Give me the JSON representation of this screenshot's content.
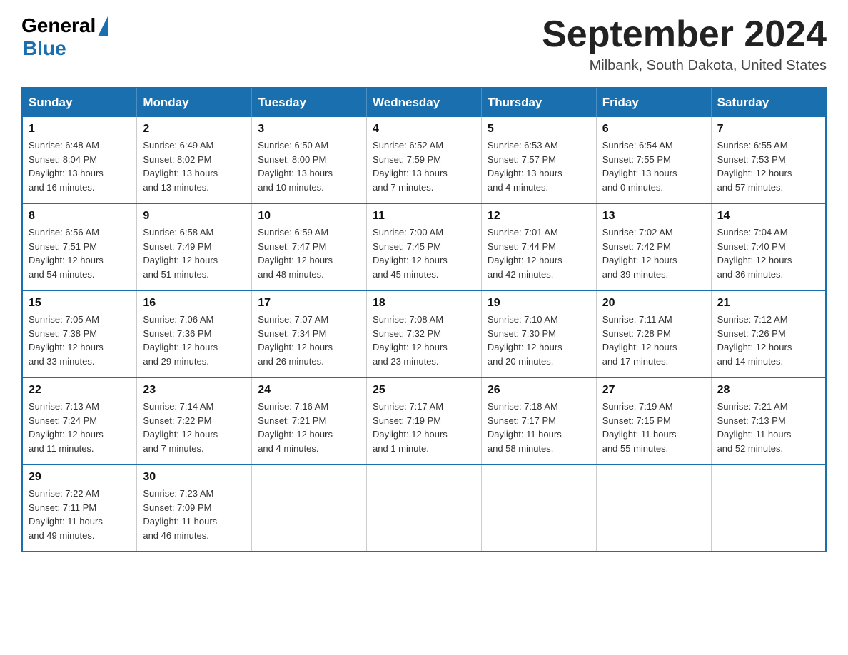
{
  "logo": {
    "general": "General",
    "blue": "Blue"
  },
  "header": {
    "month_title": "September 2024",
    "location": "Milbank, South Dakota, United States"
  },
  "days_of_week": [
    "Sunday",
    "Monday",
    "Tuesday",
    "Wednesday",
    "Thursday",
    "Friday",
    "Saturday"
  ],
  "weeks": [
    [
      {
        "day": "1",
        "sunrise": "6:48 AM",
        "sunset": "8:04 PM",
        "daylight": "13 hours and 16 minutes."
      },
      {
        "day": "2",
        "sunrise": "6:49 AM",
        "sunset": "8:02 PM",
        "daylight": "13 hours and 13 minutes."
      },
      {
        "day": "3",
        "sunrise": "6:50 AM",
        "sunset": "8:00 PM",
        "daylight": "13 hours and 10 minutes."
      },
      {
        "day": "4",
        "sunrise": "6:52 AM",
        "sunset": "7:59 PM",
        "daylight": "13 hours and 7 minutes."
      },
      {
        "day": "5",
        "sunrise": "6:53 AM",
        "sunset": "7:57 PM",
        "daylight": "13 hours and 4 minutes."
      },
      {
        "day": "6",
        "sunrise": "6:54 AM",
        "sunset": "7:55 PM",
        "daylight": "13 hours and 0 minutes."
      },
      {
        "day": "7",
        "sunrise": "6:55 AM",
        "sunset": "7:53 PM",
        "daylight": "12 hours and 57 minutes."
      }
    ],
    [
      {
        "day": "8",
        "sunrise": "6:56 AM",
        "sunset": "7:51 PM",
        "daylight": "12 hours and 54 minutes."
      },
      {
        "day": "9",
        "sunrise": "6:58 AM",
        "sunset": "7:49 PM",
        "daylight": "12 hours and 51 minutes."
      },
      {
        "day": "10",
        "sunrise": "6:59 AM",
        "sunset": "7:47 PM",
        "daylight": "12 hours and 48 minutes."
      },
      {
        "day": "11",
        "sunrise": "7:00 AM",
        "sunset": "7:45 PM",
        "daylight": "12 hours and 45 minutes."
      },
      {
        "day": "12",
        "sunrise": "7:01 AM",
        "sunset": "7:44 PM",
        "daylight": "12 hours and 42 minutes."
      },
      {
        "day": "13",
        "sunrise": "7:02 AM",
        "sunset": "7:42 PM",
        "daylight": "12 hours and 39 minutes."
      },
      {
        "day": "14",
        "sunrise": "7:04 AM",
        "sunset": "7:40 PM",
        "daylight": "12 hours and 36 minutes."
      }
    ],
    [
      {
        "day": "15",
        "sunrise": "7:05 AM",
        "sunset": "7:38 PM",
        "daylight": "12 hours and 33 minutes."
      },
      {
        "day": "16",
        "sunrise": "7:06 AM",
        "sunset": "7:36 PM",
        "daylight": "12 hours and 29 minutes."
      },
      {
        "day": "17",
        "sunrise": "7:07 AM",
        "sunset": "7:34 PM",
        "daylight": "12 hours and 26 minutes."
      },
      {
        "day": "18",
        "sunrise": "7:08 AM",
        "sunset": "7:32 PM",
        "daylight": "12 hours and 23 minutes."
      },
      {
        "day": "19",
        "sunrise": "7:10 AM",
        "sunset": "7:30 PM",
        "daylight": "12 hours and 20 minutes."
      },
      {
        "day": "20",
        "sunrise": "7:11 AM",
        "sunset": "7:28 PM",
        "daylight": "12 hours and 17 minutes."
      },
      {
        "day": "21",
        "sunrise": "7:12 AM",
        "sunset": "7:26 PM",
        "daylight": "12 hours and 14 minutes."
      }
    ],
    [
      {
        "day": "22",
        "sunrise": "7:13 AM",
        "sunset": "7:24 PM",
        "daylight": "12 hours and 11 minutes."
      },
      {
        "day": "23",
        "sunrise": "7:14 AM",
        "sunset": "7:22 PM",
        "daylight": "12 hours and 7 minutes."
      },
      {
        "day": "24",
        "sunrise": "7:16 AM",
        "sunset": "7:21 PM",
        "daylight": "12 hours and 4 minutes."
      },
      {
        "day": "25",
        "sunrise": "7:17 AM",
        "sunset": "7:19 PM",
        "daylight": "12 hours and 1 minute."
      },
      {
        "day": "26",
        "sunrise": "7:18 AM",
        "sunset": "7:17 PM",
        "daylight": "11 hours and 58 minutes."
      },
      {
        "day": "27",
        "sunrise": "7:19 AM",
        "sunset": "7:15 PM",
        "daylight": "11 hours and 55 minutes."
      },
      {
        "day": "28",
        "sunrise": "7:21 AM",
        "sunset": "7:13 PM",
        "daylight": "11 hours and 52 minutes."
      }
    ],
    [
      {
        "day": "29",
        "sunrise": "7:22 AM",
        "sunset": "7:11 PM",
        "daylight": "11 hours and 49 minutes."
      },
      {
        "day": "30",
        "sunrise": "7:23 AM",
        "sunset": "7:09 PM",
        "daylight": "11 hours and 46 minutes."
      },
      null,
      null,
      null,
      null,
      null
    ]
  ],
  "labels": {
    "sunrise": "Sunrise:",
    "sunset": "Sunset:",
    "daylight": "Daylight:"
  }
}
